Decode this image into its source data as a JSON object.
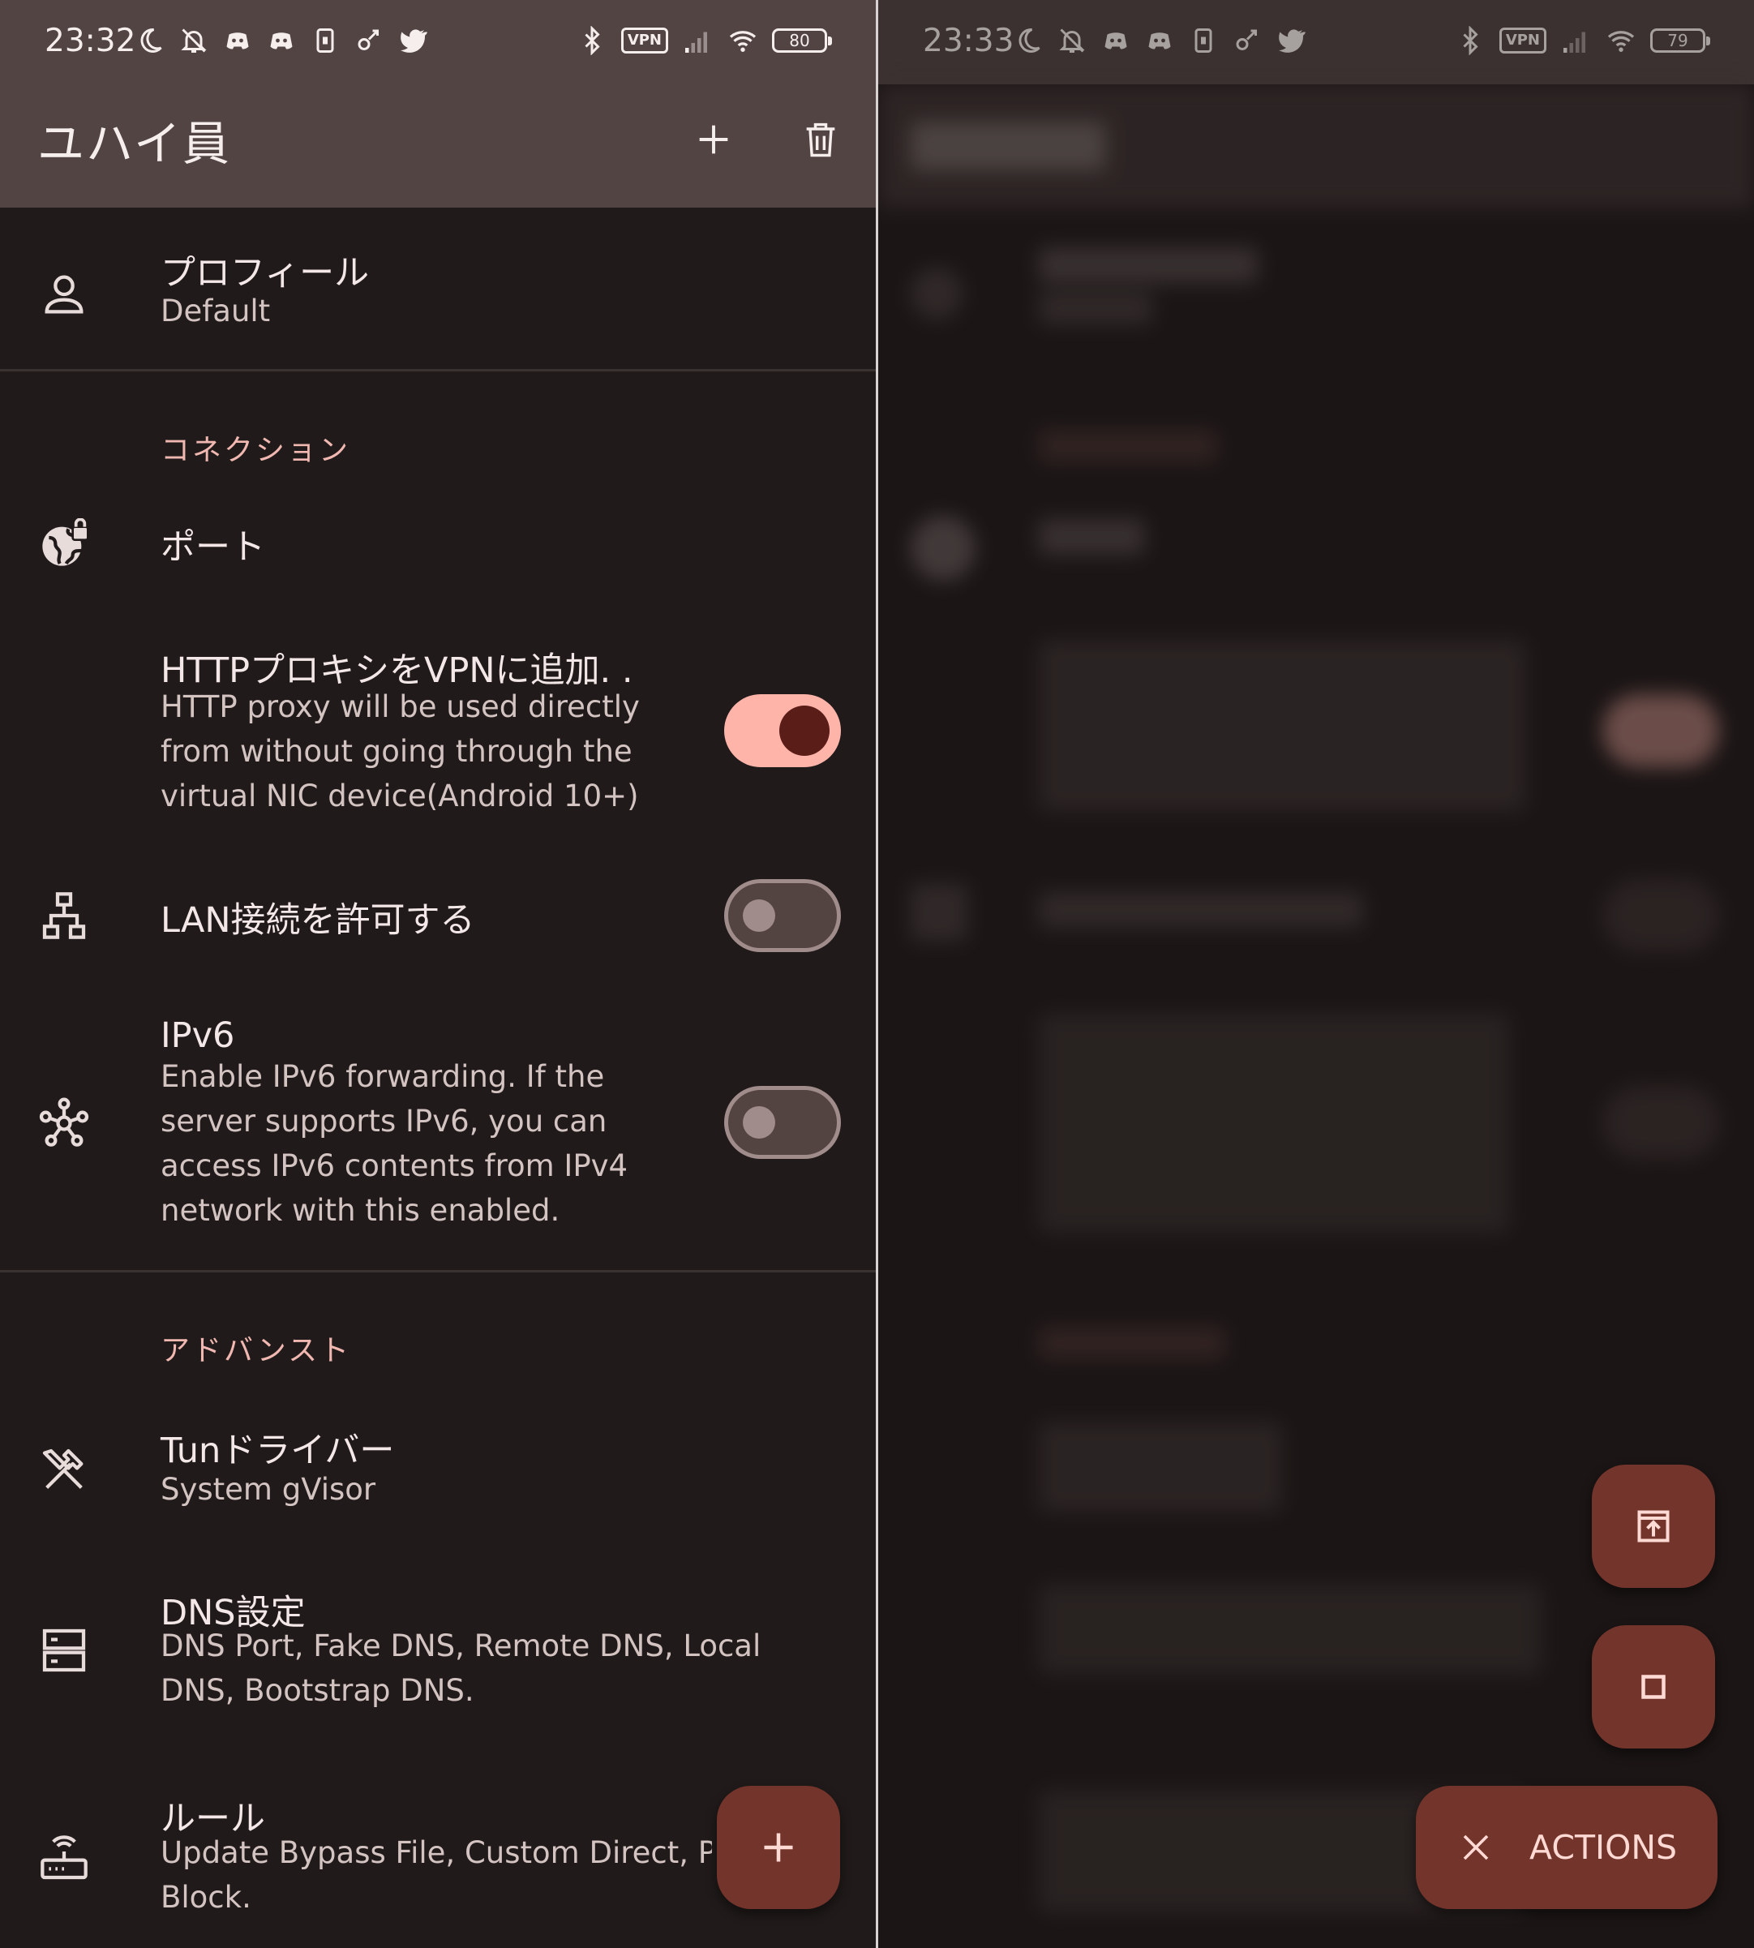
{
  "left": {
    "status": {
      "time": "23:32",
      "battery": "80",
      "vpn": "VPN"
    },
    "appbar": {
      "title": "ユハイ員"
    },
    "profile": {
      "title": "プロフィール",
      "subtitle": "Default"
    },
    "connection": {
      "header": "コネクション",
      "port": {
        "title": "ポート"
      },
      "http_proxy": {
        "title": "HTTPプロキシをVPNに追加. .",
        "line1": "HTTP proxy will be used directly",
        "line2": "from without going through the",
        "line3": "virtual NIC device(Android 10+)",
        "enabled": true
      },
      "lan": {
        "title": "LAN接続を許可する",
        "enabled": false
      },
      "ipv6": {
        "title": "IPv6",
        "line1": "Enable IPv6 forwarding. If the",
        "line2": "server supports IPv6, you can",
        "line3": "access IPv6 contents from IPv4",
        "line4": "network with this enabled.",
        "enabled": false
      }
    },
    "advanced": {
      "header": "アドバンスト",
      "tun": {
        "title": "Tunドライバー",
        "subtitle": "System gVisor"
      },
      "dns": {
        "title": "DNS設定",
        "line1": "DNS Port, Fake DNS, Remote DNS, Local",
        "line2": "DNS, Bootstrap DNS."
      },
      "rules": {
        "title": "ルール",
        "line1": "Update Bypass File, Custom Direct, P",
        "line2": "Block."
      }
    },
    "colors": {
      "surface": "#201a1a",
      "appbar": "#514443",
      "accent": "#ffb4aa",
      "fab": "#73342b"
    }
  },
  "right": {
    "status": {
      "time": "23:33",
      "battery": "79",
      "vpn": "VPN"
    },
    "actions_label": "ACTIONS"
  }
}
